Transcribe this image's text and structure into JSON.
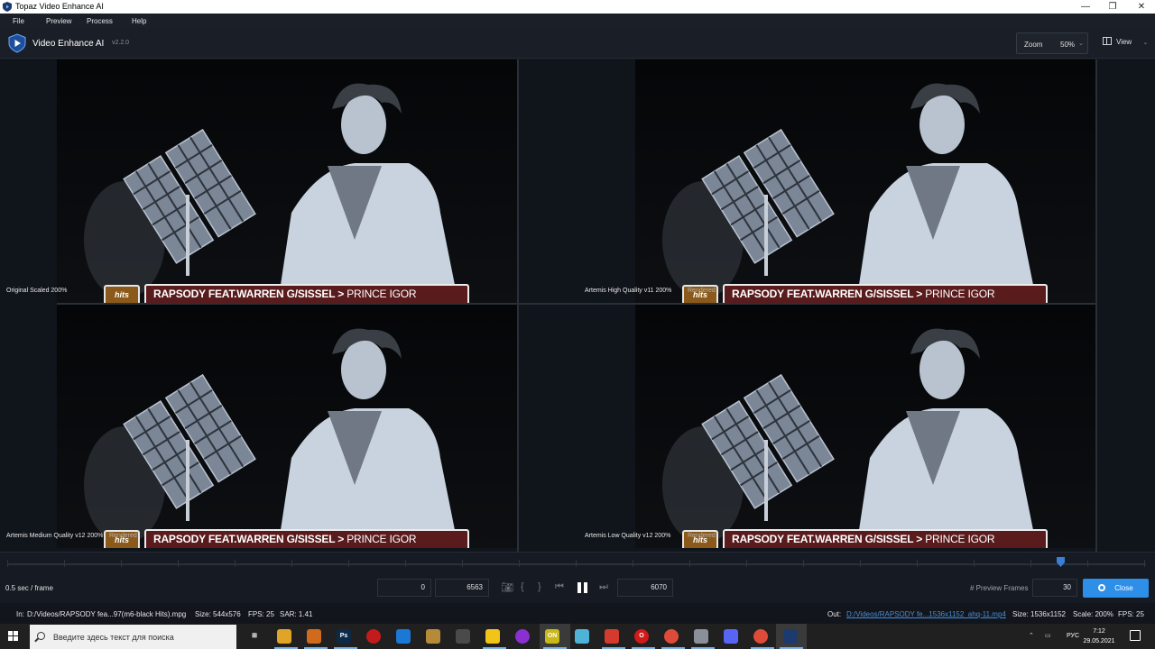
{
  "window": {
    "title": "Topaz Video Enhance AI",
    "minimize": "—",
    "restore": "❐",
    "close": "✕"
  },
  "menu": [
    "File",
    "Preview",
    "Process",
    "Help"
  ],
  "app": {
    "name": "Video Enhance AI",
    "version": "v2.2.0",
    "zoom_label": "Zoom",
    "zoom_value": "50%",
    "view_label": "View"
  },
  "panels": [
    {
      "label": "Original Scaled 200%",
      "rendered": ""
    },
    {
      "label": "Artemis High Quality v11 200%",
      "rendered": "Rendered"
    },
    {
      "label": "Artemis Medium Quality v12 200%",
      "rendered": "Rendered"
    },
    {
      "label": "Artemis Low Quality v12 200%",
      "rendered": "Rendered"
    }
  ],
  "overlay": {
    "artist": "RAPSODY FEAT.WARREN G/SISSEL",
    "separator": ">",
    "song": "PRINCE IGOR",
    "badge": "hits"
  },
  "controls": {
    "speed": "0.5 sec / frame",
    "start_frame": "0",
    "end_frame": "6563",
    "current_frame": "6070",
    "preview_frames_label": "# Preview Frames",
    "preview_frames": "30",
    "close_label": "Close"
  },
  "timeline": {
    "position_fraction": 0.925
  },
  "info": {
    "in_label": "In:",
    "in_path": "D:/Videos/RAPSODY fea...97(m6-black Hits).mpg",
    "in_size": "Size: 544x576",
    "in_fps": "FPS: 25",
    "in_sar": "SAR: 1.41",
    "out_label": "Out:",
    "out_path": "D:/Videos/RAPSODY fe...1536x1152_ahq-11.mp4",
    "out_size": "Size: 1536x1152",
    "out_scale": "Scale: 200%",
    "out_fps": "FPS: 25"
  },
  "taskbar": {
    "search_placeholder": "Введите здесь текст для поиска",
    "lang": "РУС",
    "time": "7:12",
    "date": "29.05.2021"
  },
  "colors": {
    "accent": "#2e8fe8",
    "banner": "#5a1b1d"
  }
}
